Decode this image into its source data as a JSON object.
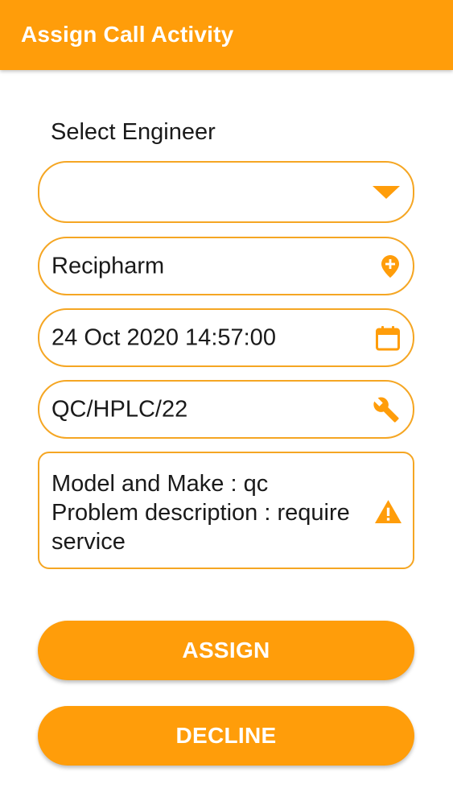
{
  "appbar": {
    "title": "Assign Call Activity",
    "color": "#FF9D0A"
  },
  "form": {
    "engineer_label": "Select Engineer",
    "engineer_value": "",
    "customer": "Recipharm",
    "datetime": "24 Oct 2020 14:57:00",
    "equipment": "QC/HPLC/22",
    "description_lines": [
      "Model and Make : qc",
      "Problem description : require",
      "service"
    ]
  },
  "icons": {
    "dropdown": "dropdown-triangle-icon",
    "customer": "location-add-icon",
    "datetime": "calendar-icon",
    "equipment": "wrench-icon",
    "description": "warning-icon"
  },
  "buttons": {
    "assign": "ASSIGN",
    "decline": "DECLINE"
  },
  "accent_color": "#F5A623"
}
